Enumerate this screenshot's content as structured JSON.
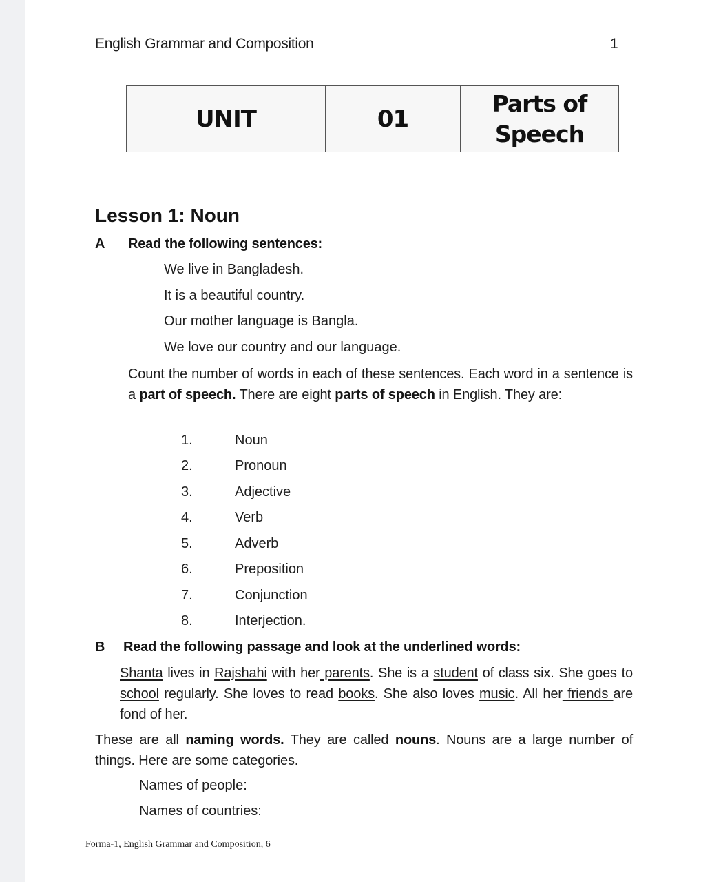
{
  "header": {
    "running_title": "English Grammar and Composition",
    "page_number": "1"
  },
  "unit_box": {
    "label": "UNIT",
    "number": "01",
    "title_line1": "Parts of",
    "title_line2": "Speech"
  },
  "lesson": {
    "title": "Lesson 1: Noun"
  },
  "section_a": {
    "letter": "A",
    "heading": "Read the following sentences:",
    "sentences": [
      "We live in Bangladesh.",
      "It is a beautiful country.",
      "Our mother language is Bangla.",
      "We love our country and our language."
    ],
    "paragraph": {
      "t1": "Count the number of words in each of these sentences. Each word in a sentence is a ",
      "b1": "part of speech.",
      "t2": " There are eight ",
      "b2": "parts of speech",
      "t3": " in English. They are:"
    },
    "parts_of_speech": [
      {
        "num": "1.",
        "term": "Noun"
      },
      {
        "num": "2.",
        "term": "Pronoun"
      },
      {
        "num": "3.",
        "term": "Adjective"
      },
      {
        "num": "4.",
        "term": "Verb"
      },
      {
        "num": "5.",
        "term": "Adverb"
      },
      {
        "num": "6.",
        "term": "Preposition"
      },
      {
        "num": "7.",
        "term": "Conjunction"
      },
      {
        "num": "8.",
        "term": "Interjection."
      }
    ]
  },
  "section_b": {
    "letter": "B",
    "heading": "Read the following passage and look at the underlined words:",
    "passage": {
      "u1": "Shanta",
      "t1": " lives in ",
      "u2": "Rajshahi",
      "t2": " with her",
      "u3": " parents",
      "t3": ". She is a ",
      "u4": "student",
      "t4": " of class six. She goes to ",
      "u5": "school",
      "t5": " regularly. She loves to read ",
      "u6": "books",
      "t6": ". She also loves ",
      "u7": "music",
      "t7": ". All her",
      "u8": " friends ",
      "t8": "are fond of her."
    },
    "explanation": {
      "t1": "These are all ",
      "b1": "naming words.",
      "t2": " They are called ",
      "b2": "nouns",
      "t3": ". Nouns are a large number of things. Here are some categories."
    },
    "categories": [
      "Names of people:",
      "Names of countries:"
    ]
  },
  "footer": {
    "text": "Forma-1, English Grammar and Composition, 6"
  }
}
